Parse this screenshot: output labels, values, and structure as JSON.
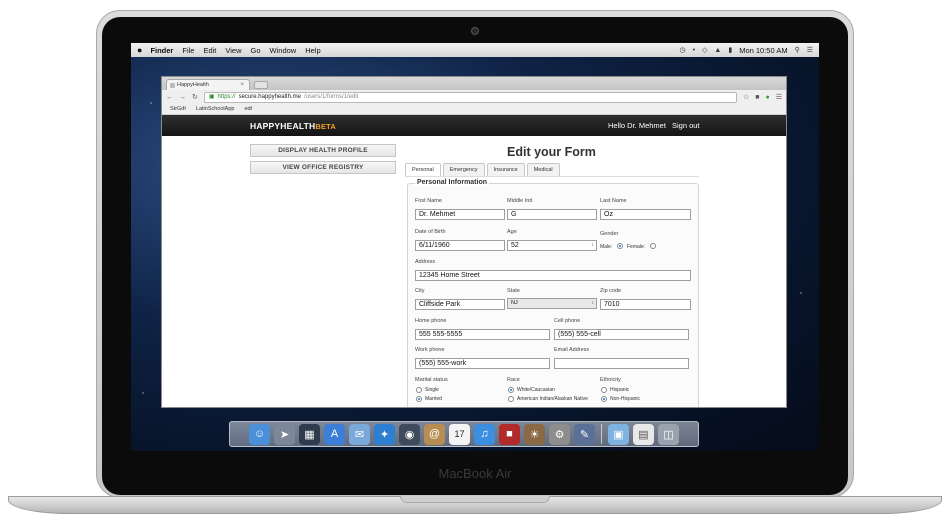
{
  "device": {
    "label": "MacBook Air"
  },
  "menubar": {
    "app": "Finder",
    "items": [
      "File",
      "Edit",
      "View",
      "Go",
      "Window",
      "Help"
    ],
    "clock": "Mon 10:50 AM"
  },
  "browser": {
    "tab_title": "HappyHealth",
    "url_scheme": "https://",
    "url_host": "secure.happyhealth.me",
    "url_path": "/users/1/forms/1/edit",
    "bookmarks": [
      "StrGdt",
      "LatinSchoolApp",
      "edt"
    ]
  },
  "site": {
    "logo_main": "HAPPYHEALTH",
    "logo_suffix": "BETA",
    "greeting": "Hello Dr. Mehmet",
    "signout": "Sign out",
    "side_buttons": [
      "DISPLAY HEALTH PROFILE",
      "VIEW OFFICE REGISTRY"
    ],
    "title": "Edit your Form",
    "tabs": [
      "Personal",
      "Emergency",
      "Insurance",
      "Medical"
    ],
    "active_tab": "Personal"
  },
  "form": {
    "legend": "Personal Information",
    "first_name": {
      "label": "First Name",
      "value": "Dr. Mehmet"
    },
    "middle_init": {
      "label": "Middle Init.",
      "value": "G"
    },
    "last_name": {
      "label": "Last Name",
      "value": "Oz"
    },
    "dob": {
      "label": "Date of Birth",
      "value": "6/11/1960"
    },
    "age": {
      "label": "Age",
      "value": "52"
    },
    "gender": {
      "label": "Gender",
      "options": [
        "Male:",
        "Female:"
      ],
      "selected": "Male:"
    },
    "address": {
      "label": "Address",
      "value": "12345 Home Street"
    },
    "city": {
      "label": "City",
      "value": "Cliffside Park"
    },
    "state": {
      "label": "State",
      "value": "NJ"
    },
    "zip": {
      "label": "Zip code",
      "value": "7010"
    },
    "home_phone": {
      "label": "Home phone",
      "value": "555 555-5555"
    },
    "cell_phone": {
      "label": "Cell phone",
      "value": "(555) 555-cell"
    },
    "work_phone": {
      "label": "Work phone",
      "value": "(555) 555-work"
    },
    "email": {
      "label": "Email Address",
      "value": ""
    },
    "marital": {
      "label": "Marital status",
      "options": [
        "Single",
        "Married"
      ],
      "selected": "Married"
    },
    "race": {
      "label": "Race",
      "options": [
        "White/Caucasian",
        "American Indian/Alaskan Native"
      ],
      "selected": "White/Caucasian"
    },
    "ethnicity": {
      "label": "Ethnicity",
      "options": [
        "Hispanic",
        "Non-Hispanic"
      ],
      "selected": "Non-Hispanic"
    }
  },
  "dock": [
    "finder-icon",
    "launchpad-icon",
    "mission-control-icon",
    "app-store-icon",
    "mail-icon",
    "safari-icon",
    "facetime-icon",
    "contacts-icon",
    "calendar-icon",
    "itunes-icon",
    "photo-booth-icon",
    "iphoto-icon",
    "system-preferences-icon",
    "textedit-icon",
    "folder-icon",
    "documents-icon",
    "trash-icon"
  ],
  "calendar_day": "17"
}
